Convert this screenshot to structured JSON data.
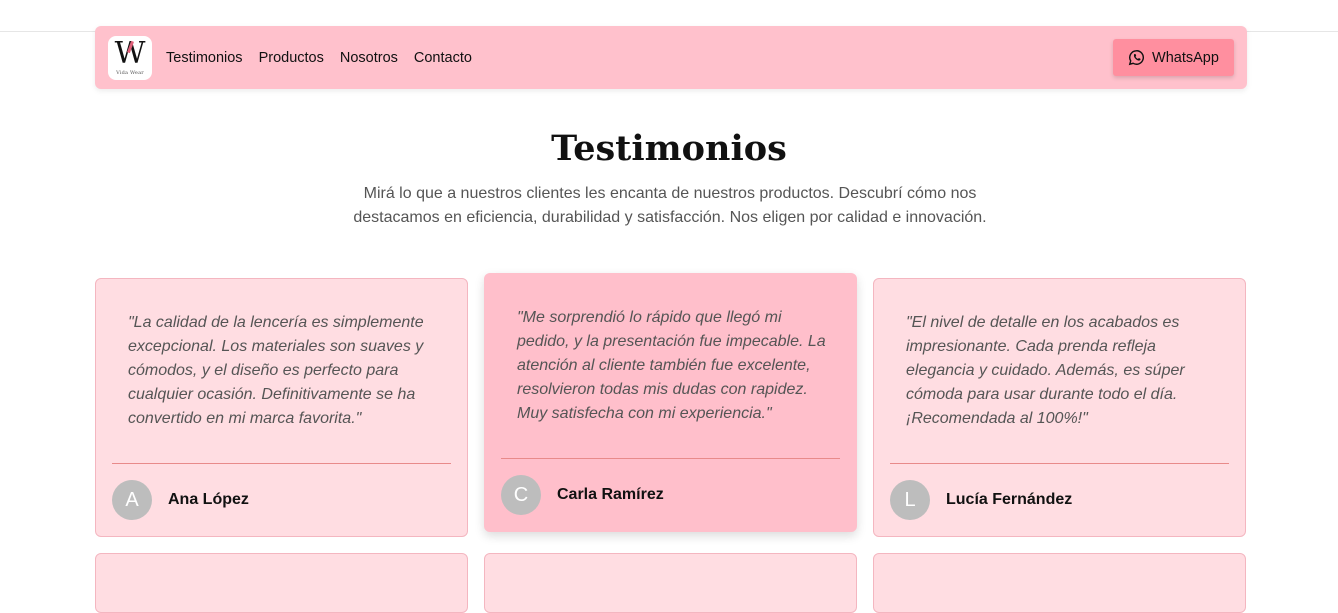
{
  "nav": {
    "logo_mark": "W",
    "logo_sub": "Vida Wear",
    "links": [
      "Testimonios",
      "Productos",
      "Nosotros",
      "Contacto"
    ],
    "whatsapp_label": "WhatsApp"
  },
  "section": {
    "title": "Testimonios",
    "subtitle": "Mirá lo que a nuestros clientes les encanta de nuestros productos. Descubrí cómo nos destacamos en eficiencia, durabilidad y satisfacción. Nos eligen por calidad e innovación."
  },
  "testimonials": [
    {
      "quote": "\"La calidad de la lencería es simplemente excepcional. Los materiales son suaves y cómodos, y el diseño es perfecto para cualquier ocasión. Definitivamente se ha convertido en mi marca favorita.\"",
      "initial": "A",
      "name": "Ana López"
    },
    {
      "quote": "\"Me sorprendió lo rápido que llegó mi pedido, y la presentación fue impecable. La atención al cliente también fue excelente, resolvieron todas mis dudas con rapidez. Muy satisfecha con mi experiencia.\"",
      "initial": "C",
      "name": "Carla Ramírez"
    },
    {
      "quote": "\"El nivel de detalle en los acabados es impresionante. Cada prenda refleja elegancia y cuidado. Además, es súper cómoda para usar durante todo el día. ¡Recomendada al 100%!\"",
      "initial": "L",
      "name": "Lucía Fernández"
    }
  ],
  "colors": {
    "navbar": "#ffc1cc",
    "whatsapp_button": "#ff8f9f",
    "card": "#ffdde2",
    "card_featured": "#ffbfcb",
    "divider": "#e88a8a",
    "avatar": "#bdbdbd"
  }
}
